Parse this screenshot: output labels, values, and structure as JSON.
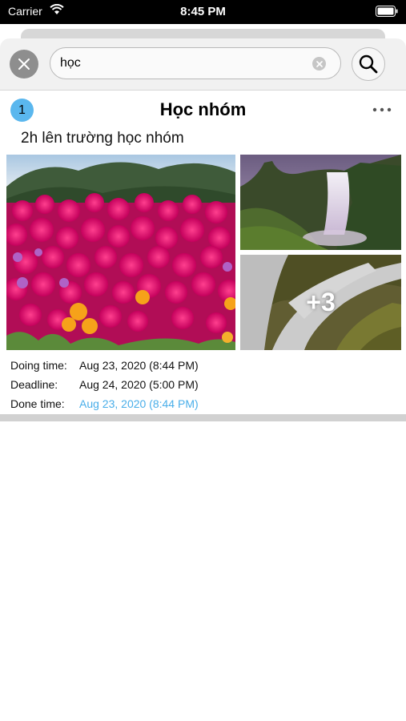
{
  "status_bar": {
    "carrier": "Carrier",
    "time": "8:45 PM"
  },
  "search": {
    "query": "học"
  },
  "task": {
    "index": "1",
    "title": "Học nhóm",
    "description": "2h lên trường học nhóm",
    "extra_photos": "+3",
    "times": [
      {
        "label": "Doing time:",
        "value": "Aug 23, 2020  (8:44 PM)"
      },
      {
        "label": "Deadline:",
        "value": "Aug 24, 2020  (5:00 PM)"
      },
      {
        "label": "Done time:",
        "value": "Aug 23, 2020  (8:44 PM)"
      }
    ]
  },
  "colors": {
    "accent": "#49aee9",
    "badge": "#5ab7ee"
  }
}
